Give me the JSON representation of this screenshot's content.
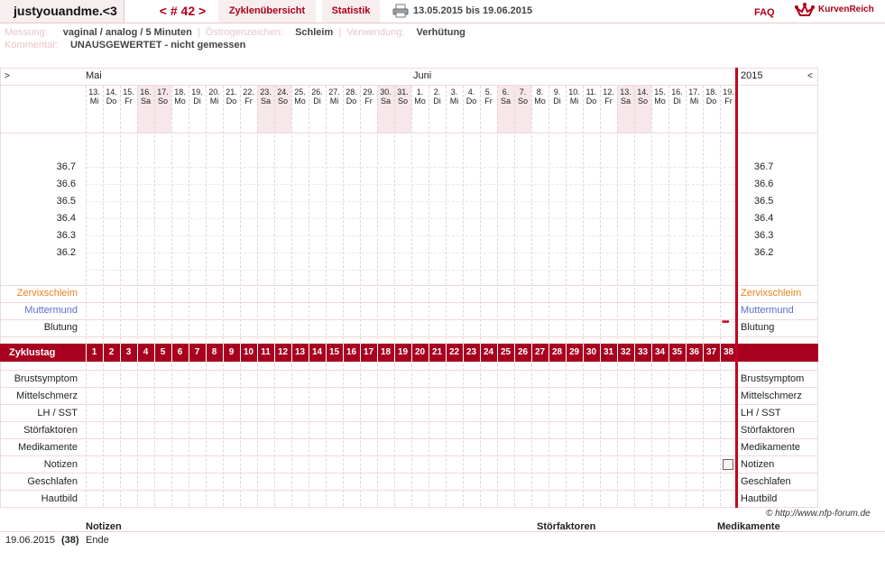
{
  "header": {
    "brand": "justyouandme.<3",
    "cycle_nav": "< # 42 >",
    "tab_cycles": "Zyklenübersicht",
    "tab_stats": "Statistik",
    "date_range": "13.05.2015 bis 19.06.2015",
    "faq": "FAQ",
    "logo_text": "KurvenReich"
  },
  "meta": {
    "messung_label": "Messung:",
    "messung_value": "vaginal / analog / 5 Minuten",
    "oestrogen_label": "Östrogenzeichen:",
    "oestrogen_value": "Schleim",
    "verwendung_label": "Verwendung:",
    "verwendung_value": "Verhütung",
    "kommentar_label": "Kommentar:",
    "kommentar_value": "UNAUSGEWERTET - nicht gemessen"
  },
  "chart": {
    "nav_left": ">",
    "nav_right": "<",
    "month_mai": "Mai",
    "month_juni": "Juni",
    "year": "2015",
    "days": [
      {
        "d": "13.",
        "w": "Mi"
      },
      {
        "d": "14.",
        "w": "Do"
      },
      {
        "d": "15.",
        "w": "Fr"
      },
      {
        "d": "16.",
        "w": "Sa"
      },
      {
        "d": "17.",
        "w": "So"
      },
      {
        "d": "18.",
        "w": "Mo"
      },
      {
        "d": "19.",
        "w": "Di"
      },
      {
        "d": "20.",
        "w": "Mi"
      },
      {
        "d": "21.",
        "w": "Do"
      },
      {
        "d": "22.",
        "w": "Fr"
      },
      {
        "d": "23.",
        "w": "Sa"
      },
      {
        "d": "24.",
        "w": "So"
      },
      {
        "d": "25.",
        "w": "Mo"
      },
      {
        "d": "26.",
        "w": "Di"
      },
      {
        "d": "27.",
        "w": "Mi"
      },
      {
        "d": "28.",
        "w": "Do"
      },
      {
        "d": "29.",
        "w": "Fr"
      },
      {
        "d": "30.",
        "w": "Sa"
      },
      {
        "d": "31.",
        "w": "So"
      },
      {
        "d": "1.",
        "w": "Mo"
      },
      {
        "d": "2.",
        "w": "Di"
      },
      {
        "d": "3.",
        "w": "Mi"
      },
      {
        "d": "4.",
        "w": "Do"
      },
      {
        "d": "5.",
        "w": "Fr"
      },
      {
        "d": "6.",
        "w": "Sa"
      },
      {
        "d": "7.",
        "w": "So"
      },
      {
        "d": "8.",
        "w": "Mo"
      },
      {
        "d": "9.",
        "w": "Di"
      },
      {
        "d": "10.",
        "w": "Mi"
      },
      {
        "d": "11.",
        "w": "Do"
      },
      {
        "d": "12.",
        "w": "Fr"
      },
      {
        "d": "13.",
        "w": "Sa"
      },
      {
        "d": "14.",
        "w": "So"
      },
      {
        "d": "15.",
        "w": "Mo"
      },
      {
        "d": "16.",
        "w": "Di"
      },
      {
        "d": "17.",
        "w": "Mi"
      },
      {
        "d": "18.",
        "w": "Do"
      },
      {
        "d": "19.",
        "w": "Fr"
      }
    ],
    "temps": [
      "36.7",
      "36.6",
      "36.5",
      "36.4",
      "36.3",
      "36.2"
    ],
    "zervix": "Zervixschleim",
    "muttermund": "Muttermund",
    "blutung": "Blutung",
    "zyklustag": "Zyklustag",
    "cycle_days": [
      "1",
      "2",
      "3",
      "4",
      "5",
      "6",
      "7",
      "8",
      "9",
      "10",
      "11",
      "12",
      "13",
      "14",
      "15",
      "16",
      "17",
      "18",
      "19",
      "20",
      "21",
      "22",
      "23",
      "24",
      "25",
      "26",
      "27",
      "28",
      "29",
      "30",
      "31",
      "32",
      "33",
      "34",
      "35",
      "36",
      "37",
      "38"
    ],
    "rows_below": [
      "Brustsymptom",
      "Mittelschmerz",
      "LH / SST",
      "Störfaktoren",
      "Medikamente",
      "Notizen",
      "Geschlafen",
      "Hautbild"
    ],
    "blutung_marker": "•••",
    "colors": {
      "accent": "#a8001f",
      "weekend": "#f6e8ea",
      "zervix": "#e8811a",
      "muttermund": "#5a6ed0"
    }
  },
  "footer": {
    "copyright": "© http://www.nfp-forum.de",
    "col_notizen": "Notizen",
    "col_stoerfaktoren": "Störfaktoren",
    "col_medikamente": "Medikamente",
    "row_date": "19.06.2015",
    "row_day": "(38)",
    "row_note": "Ende"
  }
}
